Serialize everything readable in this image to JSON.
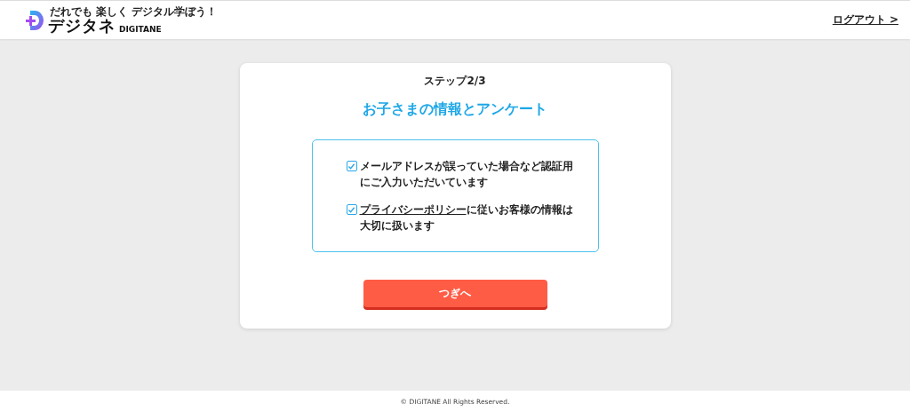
{
  "header": {
    "logo": {
      "tagline": "だれでも 楽しく デジタル学ぼう！",
      "name": "デジタネ",
      "name_latin": "DIGITANE"
    },
    "logout_link": "ログアウト >"
  },
  "card": {
    "step": "ステップ2/3",
    "title": "お子さまの情報とアンケート",
    "agreements": [
      {
        "checked": true,
        "text": "メールアドレスが誤っていた場合など認証用にご入力いただいています"
      },
      {
        "checked": true,
        "link": "プライバシーポリシー",
        "text": "に従いお客様の情報は大切に扱います"
      }
    ],
    "next_button": "つぎへ"
  },
  "footer": {
    "copyright": "© DIGITANE All Rights Reserved."
  }
}
